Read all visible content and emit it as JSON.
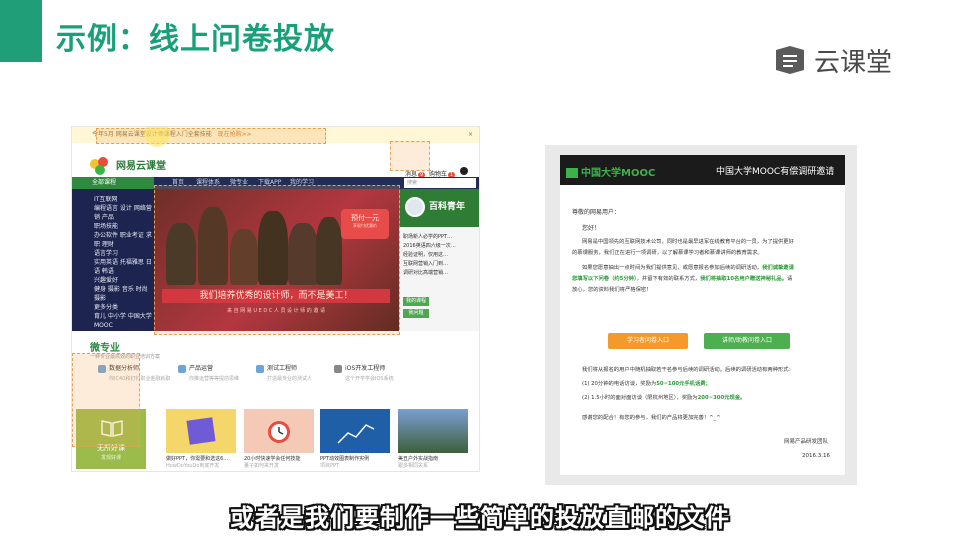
{
  "slide": {
    "title": "示例：线上问卷投放",
    "brand": "云课堂",
    "subtitle": "或者是我们要制作一些简单的投放直邮的文件",
    "accent_color": "#1f9e77"
  },
  "left_site": {
    "notice_text": "今年5月 网易云课堂设计师课程入门全套技能",
    "notice_link": "现在抢购>>",
    "logo": "网易云课堂",
    "header_links": [
      {
        "label": "消息",
        "badge": "9"
      },
      {
        "label": "购物车",
        "badge": "1"
      }
    ],
    "nav": {
      "category_label": "全部课程",
      "items": [
        "首页",
        "课程体系",
        "微专业",
        "下载APP",
        "我的学习"
      ],
      "search_placeholder": "搜索"
    },
    "category_lines": [
      "IT互联网",
      "编程语言 设计 网络营",
      "销 产品",
      "职场技能",
      "办公软件 职业考证 求",
      "职 理财",
      "语言学习",
      "实用英语 托福雅思 日",
      "语 韩语",
      "兴趣爱好",
      "健身 摄影 音乐 时尚",
      "摄影",
      "更多分类",
      "育儿 中小学 中国大学",
      "MOOC"
    ],
    "banner": {
      "badge_line1": "预付一元",
      "badge_line2": "享现付优惠价",
      "slogan": "我们培养优秀的设计师，而不是美工！",
      "sub": "来 自 网 易 U E D C 人 员 设 计 师 的 邀 请"
    },
    "side_promo": {
      "title": "百科青年",
      "lines": [
        "职场新人必学的PPT…",
        "2016英语四六级一次…",
        "经验证明，仅用这…",
        "互联网营销入门到…",
        "调研对比高端营销…"
      ],
      "buttons": [
        "我的课程",
        "我问题"
      ]
    },
    "section": {
      "title": "微专业",
      "subtitle": "一种专业最高效的职业培训方案",
      "features": [
        {
          "label": "数据分析师",
          "sub": "你IC40和钉钉职业金融就职"
        },
        {
          "label": "产品运营",
          "sub": "你推运营等等提前思维"
        },
        {
          "label": "测试工程师",
          "sub": "打造最专业的测试人"
        },
        {
          "label": "iOS开发工程师",
          "sub": "这个开学学会IOS系统"
        }
      ]
    },
    "cards": [
      {
        "caption": "无所好课",
        "sub": "发现好课"
      },
      {
        "caption": "做好PPT，你需要和选这6…",
        "sub": "HowDoYouDo到底开发"
      },
      {
        "caption": "20小时快速学会任何技能",
        "sub": "董子如何来开发"
      },
      {
        "caption": "PPT动效图表制作实例",
        "sub": "项目PPT"
      },
      {
        "caption": "美丑户外实战指南",
        "sub": "跟多相同关系"
      }
    ]
  },
  "right_mail": {
    "logo": "中国大学MOOC",
    "title": "中国大学MOOC有偿调研邀请",
    "greeting": "尊敬的网易用户：",
    "hello": "您好！",
    "p1_a": "网易是中国领先的互联网技术公司，同时也是最早进军在线教育平台的一员，为了提供更好",
    "p1_b": "的慕课服务，我们正在进行一项调研，以了解慕课学习者和慕课讲师的教育需求。",
    "p2_a": "如果您愿意抽出一点时间为我们提供意见，或愿意报名参加后续的调研活动，",
    "p2_highlight": "我们诚挚邀请",
    "p2_b_highlight": "您填写以下问卷（约5分钟）",
    "p2_b": "，并留下有效的联系方式，",
    "p2_c_highlight": "我们将抽取10名用户赠送神秘礼品。",
    "p2_d": "请",
    "p2_e": "放心，您的资料我们将严格保密！",
    "btn_learner": "学习者问卷入口",
    "btn_teacher": "讲师/助教问卷入口",
    "p3": "我们将从报名的用户中随机抽取若干名参与后续的调研活动。后续的调研活动有两种形式：",
    "p3_1_a": "(1) 20分钟的电话访谈，奖励为",
    "p3_1_b": "50~100元手机话费；",
    "p3_2_a": "(2) 1.5小时的面对面访谈（限杭州地区），奖励为",
    "p3_2_b": "200~300元现金。",
    "thanks": "感谢您的配合！有您的参与，我们的产品将更加完善！^_^",
    "sign": "网易产品研发团队",
    "date": "2016.3.16"
  }
}
